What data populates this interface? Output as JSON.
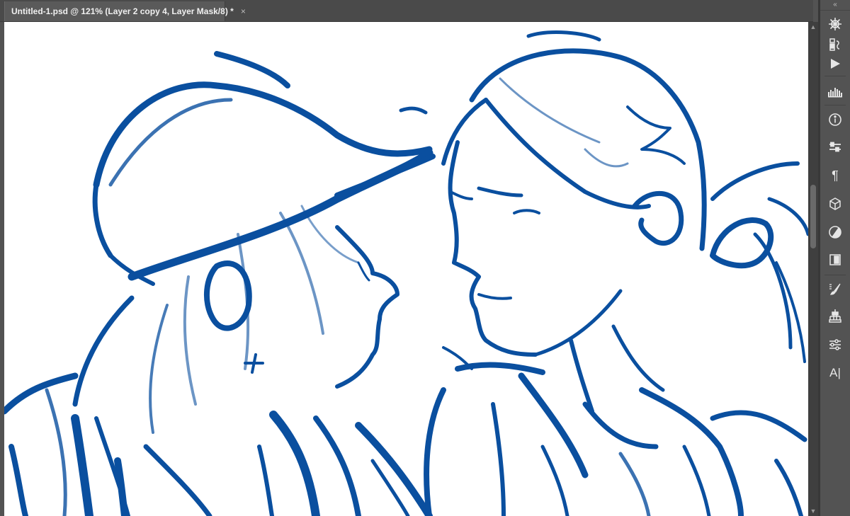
{
  "document_tab": {
    "title": "Untitled-1.psd @ 121% (Layer 2 copy 4, Layer Mask/8) *",
    "close_glyph": "×"
  },
  "scrollbar": {
    "up_glyph": "▲",
    "down_glyph": "▼"
  },
  "panel_dock": {
    "collapse_glyph": "«",
    "icons": [
      {
        "name": "navigator-icon"
      },
      {
        "name": "swatches-icon"
      },
      {
        "name": "actions-play-icon"
      },
      {
        "name": "histogram-icon"
      },
      {
        "name": "info-icon",
        "glyph": "ⓘ"
      },
      {
        "name": "properties-icon"
      },
      {
        "name": "paragraph-icon",
        "glyph": "¶"
      },
      {
        "name": "3d-icon"
      },
      {
        "name": "adjustments-icon"
      },
      {
        "name": "libraries-icon"
      },
      {
        "name": "brush-settings-icon"
      },
      {
        "name": "clone-source-icon"
      },
      {
        "name": "sliders-icon"
      },
      {
        "name": "character-icon",
        "glyph": "A|"
      }
    ]
  },
  "canvas": {
    "stroke_color": "#0a4f9f",
    "background": "#ffffff"
  }
}
